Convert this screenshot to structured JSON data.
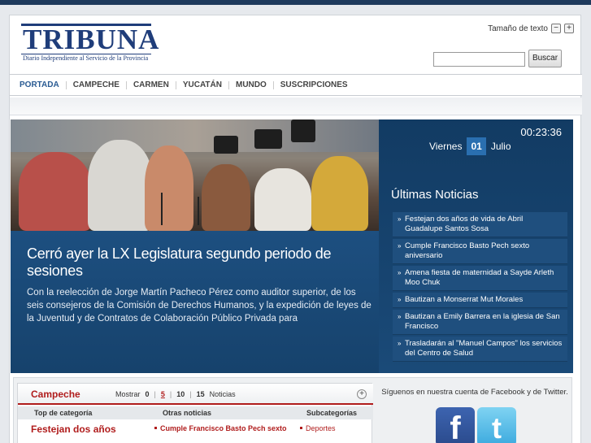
{
  "logo": {
    "word": "TRIBUNA",
    "tagline": "Diario Independiente al Servicio de la Provincia"
  },
  "header": {
    "text_size_label": "Tamaño de texto",
    "decrease": "−",
    "increase": "+",
    "search_placeholder": "",
    "search_button": "Buscar"
  },
  "nav": {
    "items": [
      "PORTADA",
      "CAMPECHE",
      "CARMEN",
      "YUCATÁN",
      "MUNDO",
      "SUSCRIPCIONES"
    ]
  },
  "hero": {
    "title": "Cerró ayer la LX Legislatura segundo periodo de sesiones",
    "description": "Con la reelección de Jorge Martín Pacheco Pérez como auditor superior, de los seis consejeros de la Comisión de Derechos Humanos, y la expedición de leyes de la Juventud y de Contratos de Colaboración Público Privada para"
  },
  "sidebar": {
    "clock": "00:23:36",
    "weekday": "Viernes",
    "day": "01",
    "month": "Julio",
    "heading": "Últimas Noticias",
    "bullet": "»",
    "news": [
      "Festejan dos años de vida de Abril Guadalupe Santos Sosa",
      "Cumple Francisco Basto Pech sexto aniversario",
      "Amena fiesta de maternidad a Sayde Arleth Moo Chuk",
      "Bautizan a Monserrat Mut Morales",
      "Bautizan a Emily Barrera en la iglesia de San Francisco",
      "Trasladarán al \"Manuel Campos\" los servicios del Centro de Salud"
    ]
  },
  "panel": {
    "title": "Campeche",
    "mostrar_label": "Mostrar",
    "counts": [
      "0",
      "5",
      "10",
      "15"
    ],
    "noticias_label": "Noticias",
    "expand": "+",
    "col_top": "Top de categoría",
    "col_other": "Otras noticias",
    "col_sub": "Subcategorías",
    "top_story": "Festejan dos años",
    "other_story": "Cumple Francisco Basto Pech sexto",
    "sub_item": "Deportes"
  },
  "social": {
    "text": "Síguenos en nuestra cuenta de Facebook y de Twitter.",
    "fb_glyph": "f",
    "tw_glyph": "t"
  }
}
